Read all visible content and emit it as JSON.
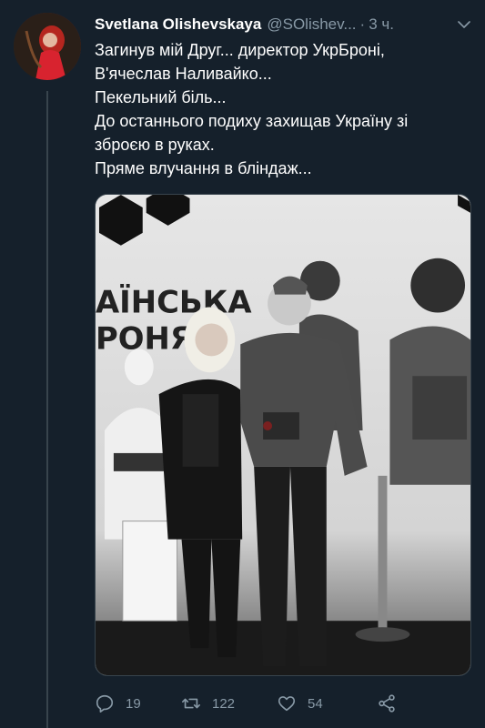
{
  "tweet": {
    "author_name": "Svetlana Olishevskaya",
    "author_handle": "@SOlishev...",
    "separator": "·",
    "time": "3 ч.",
    "text_lines": [
      "Загинув мій Друг... директор УкрБроні,",
      "В'ячеслав Наливайко...",
      "Пекельний біль...",
      "До останнього подиху захищав Україну зі",
      "зброєю в руках.",
      "Пряме влучання в бліндаж..."
    ]
  },
  "media": {
    "sign_text_line1": "АЇНСЬКА",
    "sign_text_line2": "РОНЯ"
  },
  "actions": {
    "replies": "19",
    "retweets": "122",
    "likes": "54"
  },
  "icons": [
    "more-caret-icon",
    "reply-icon",
    "retweet-icon",
    "like-icon",
    "share-icon"
  ],
  "colors": {
    "background": "#15202b",
    "text_primary": "#ffffff",
    "text_secondary": "#8899a6",
    "divider": "#38444d"
  }
}
